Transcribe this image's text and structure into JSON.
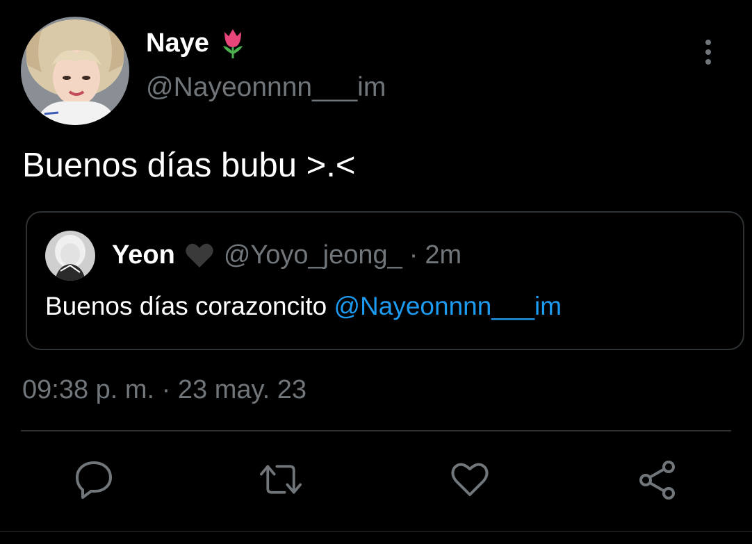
{
  "author": {
    "display_name": "Naye",
    "name_emoji": "tulip-icon",
    "handle": "@Nayeonnnn___im"
  },
  "tweet": {
    "text": "Buenos días bubu >.<",
    "timestamp": "09:38 p. m. · 23 may. 23"
  },
  "quoted": {
    "display_name": "Yeon",
    "name_emoji": "black-heart-icon",
    "handle": "@Yoyo_jeong_",
    "separator": "·",
    "time": "2m",
    "text": "Buenos días corazoncito ",
    "mention": "@Nayeonnnn___im"
  },
  "actions": [
    "reply-icon",
    "retweet-icon",
    "like-icon",
    "share-icon"
  ],
  "colors": {
    "background": "#000000",
    "primary_text": "#ffffff",
    "secondary_text": "#71767b",
    "accent": "#1d9bf0",
    "border": "#2f3336"
  }
}
